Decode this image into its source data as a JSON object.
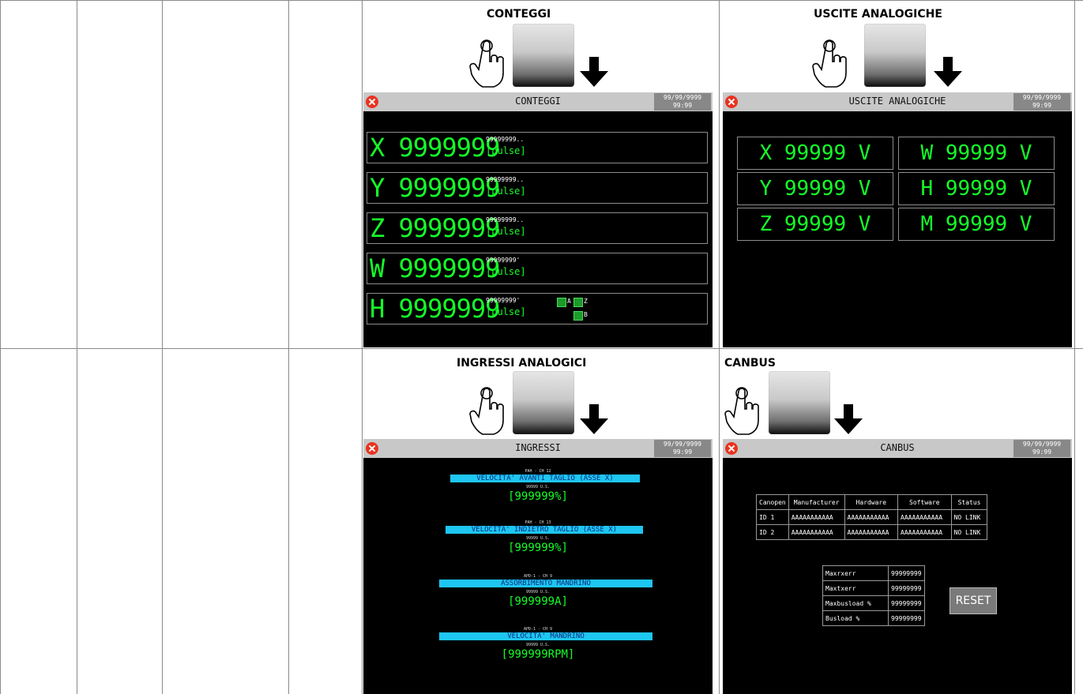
{
  "panels": {
    "conteggi": {
      "heading": "CONTEGGI",
      "screen_title": "CONTEGGI",
      "date": "99/99/9999",
      "time": "99:99",
      "rows": [
        {
          "value": "X 9999999",
          "small": "99999999..",
          "unit": "[pulse]"
        },
        {
          "value": "Y 9999999",
          "small": "99999999..",
          "unit": "[pulse]"
        },
        {
          "value": "Z 9999999",
          "small": "99999999..",
          "unit": "[pulse]"
        },
        {
          "value": "W 9999999",
          "small": "99999999'",
          "unit": "[pulse]"
        },
        {
          "value": "H 9999999",
          "small": "99999999'",
          "unit": "[pulse]"
        }
      ],
      "leds": {
        "a": "A",
        "z": "Z",
        "b": "B"
      }
    },
    "uscite": {
      "heading": "USCITE ANALOGICHE",
      "screen_title": "USCITE ANALOGICHE",
      "date": "99/99/9999",
      "time": "99:99",
      "values": [
        "X 99999 V",
        "W 99999 V",
        "Y 99999 V",
        "H 99999 V",
        "Z 99999 V",
        "M 99999 V"
      ]
    },
    "ingressi": {
      "heading": "INGRESSI ANALOGICI",
      "screen_title": "INGRESSI",
      "date": "99/99/9999",
      "time": "99:99",
      "items": [
        {
          "tag": "PAH - CH 12",
          "label": "VELOCITA' AVANTI TAGLIO (ASSE X)",
          "range": "99999 U.S.",
          "value": "[999999%]"
        },
        {
          "tag": "PAH - CH 13",
          "label": "VELOCITA' INDIETRO TAGLIO (ASSE X)",
          "range": "99999 U.S.",
          "value": "[999999%]"
        },
        {
          "tag": "APD-1 - CH 9",
          "label": "ASSORBIMENTO MANDRINO",
          "range": "99999 U.S.",
          "value": "[999999A]"
        },
        {
          "tag": "APD-1 - CH 9",
          "label": "VELOCITA' MANDRINO",
          "range": "99999 U.S.",
          "value": "[999999RPM]"
        }
      ]
    },
    "canbus": {
      "heading": "CANBUS",
      "screen_title": "CANBUS",
      "date": "99/99/9999",
      "time": "99:99",
      "table_headers": [
        "Canopen",
        "Manufacturer",
        "Hardware",
        "Software",
        "Status"
      ],
      "table_rows": [
        [
          "ID 1",
          "AAAAAAAAAAA",
          "AAAAAAAAAAA",
          "AAAAAAAAAAA",
          "NO LINK"
        ],
        [
          "ID 2",
          "AAAAAAAAAAA",
          "AAAAAAAAAAA",
          "AAAAAAAAAAA",
          "NO LINK"
        ]
      ],
      "stats": [
        [
          "Maxrxerr",
          "99999999"
        ],
        [
          "Maxtxerr",
          "99999999"
        ],
        [
          "Maxbusload %",
          "99999999"
        ],
        [
          "Busload %",
          "99999999"
        ]
      ],
      "reset_label": "RESET"
    }
  }
}
